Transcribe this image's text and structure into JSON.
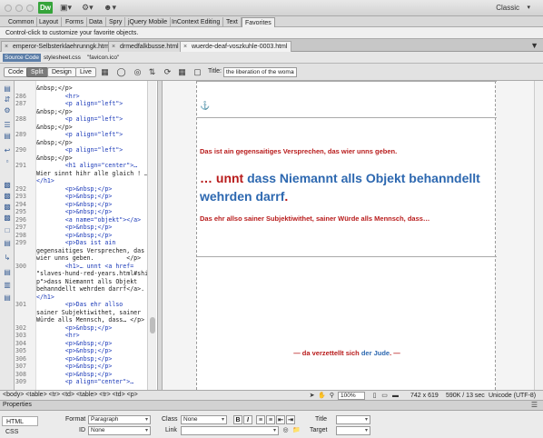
{
  "titlebar": {
    "app_logo": "Dw",
    "workspace": "Classic"
  },
  "insert_tabs": [
    {
      "label": "Common"
    },
    {
      "label": "Layout"
    },
    {
      "label": "Forms"
    },
    {
      "label": "Data"
    },
    {
      "label": "Spry"
    },
    {
      "label": "jQuery Mobile"
    },
    {
      "label": "InContext Editing"
    },
    {
      "label": "Text"
    },
    {
      "label": "Favorites"
    }
  ],
  "favorites_hint": "Control-click to customize your favorite objects.",
  "doc_tabs": [
    {
      "label": "emperor-Selbsterklaehrunngk.html"
    },
    {
      "label": "drmedfalkbusse.html"
    },
    {
      "label": "wuerde-deaf-voszkuhle-0003.html"
    }
  ],
  "related_files": {
    "source": "Source Code",
    "items": [
      "stylesheet.css",
      "\"favicon.ico\""
    ]
  },
  "view_buttons": {
    "code": "Code",
    "split": "Split",
    "design": "Design",
    "live": "Live"
  },
  "title_field": {
    "label": "Title:",
    "value": "the liberation of the woman is"
  },
  "code_lines": [
    {
      "num": "",
      "text": "&nbsp;</p>"
    },
    {
      "num": "286",
      "text": "        <hr>"
    },
    {
      "num": "287",
      "text": "        <p align=\"left\">"
    },
    {
      "num": "",
      "text": "&nbsp;</p>"
    },
    {
      "num": "288",
      "text": "        <p align=\"left\">"
    },
    {
      "num": "",
      "text": "&nbsp;</p>"
    },
    {
      "num": "289",
      "text": "        <p align=\"left\">"
    },
    {
      "num": "",
      "text": "&nbsp;</p>"
    },
    {
      "num": "290",
      "text": "        <p align=\"left\">"
    },
    {
      "num": "",
      "text": "&nbsp;</p>"
    },
    {
      "num": "291",
      "text": "        <h1 align=\"center\">…"
    },
    {
      "num": "",
      "text": "Wier sinnt hihr alle glaich ! …"
    },
    {
      "num": "",
      "text": "</h1>"
    },
    {
      "num": "292",
      "text": "        <p>&nbsp;</p>"
    },
    {
      "num": "293",
      "text": "        <p>&nbsp;</p>"
    },
    {
      "num": "294",
      "text": "        <p>&nbsp;</p>"
    },
    {
      "num": "295",
      "text": "        <p>&nbsp;</p>"
    },
    {
      "num": "296",
      "text": "        <a name=\"objekt\"></a>"
    },
    {
      "num": "297",
      "text": "        <p>&nbsp;</p>"
    },
    {
      "num": "298",
      "text": "        <p>&nbsp;</p>"
    },
    {
      "num": "299",
      "text": "        <p>Das ist ain"
    },
    {
      "num": "",
      "text": "gegensaitiges Versprechen, das"
    },
    {
      "num": "",
      "text": "wier unns geben.         </p>"
    },
    {
      "num": "300",
      "text": "        <h1>… unnt <a href="
    },
    {
      "num": "",
      "text": "\"slaves-hund-red-years.html#shi"
    },
    {
      "num": "",
      "text": "p\">dass Niemannt alls Objekt"
    },
    {
      "num": "",
      "text": "behanndellt wehrden darrf</a>."
    },
    {
      "num": "",
      "text": "</h1>"
    },
    {
      "num": "301",
      "text": "        <p>Das ehr allso"
    },
    {
      "num": "",
      "text": "sainer Subjektiwithet, sainer"
    },
    {
      "num": "",
      "text": "Würde alls Mennsch, dass… </p>"
    },
    {
      "num": "302",
      "text": "        <p>&nbsp;</p>"
    },
    {
      "num": "303",
      "text": "        <hr>"
    },
    {
      "num": "304",
      "text": "        <p>&nbsp;</p>"
    },
    {
      "num": "305",
      "text": "        <p>&nbsp;</p>"
    },
    {
      "num": "306",
      "text": "        <p>&nbsp;</p>"
    },
    {
      "num": "307",
      "text": "        <p>&nbsp;</p>"
    },
    {
      "num": "308",
      "text": "        <p>&nbsp;</p>"
    },
    {
      "num": "309",
      "text": "        <p align=\"center\">…"
    }
  ],
  "design": {
    "p1": "Das ist ain gegensaitiges Versprechen, das wier unns geben.",
    "h1_prefix": "… unnt ",
    "h1_link": "dass Niemannt alls Objekt behanndellt wehrden darrf",
    "h1_suffix": ".",
    "p2": "Das ehr allso sainer Subjektiwithet, sainer Würde alls Mennsch, dass…",
    "footer_prefix": "— da verzettellt sich ",
    "footer_link": "der Jude",
    "footer_suffix": ". —"
  },
  "statusbar": {
    "tag_selector": "<body> <table> <tr> <td> <table> <tr> <td> <p>",
    "zoom": "100%",
    "dimensions": "742 x 619",
    "download": "590K / 13 sec",
    "encoding": "Unicode (UTF-8)"
  },
  "properties": {
    "title": "Properties",
    "tab_html": "HTML",
    "tab_css": "CSS",
    "format_label": "Format",
    "format_value": "Paragraph",
    "class_label": "Class",
    "class_value": "None",
    "id_label": "ID",
    "id_value": "None",
    "link_label": "Link",
    "title_label": "Title",
    "target_label": "Target",
    "bold": "B",
    "italic": "I"
  }
}
